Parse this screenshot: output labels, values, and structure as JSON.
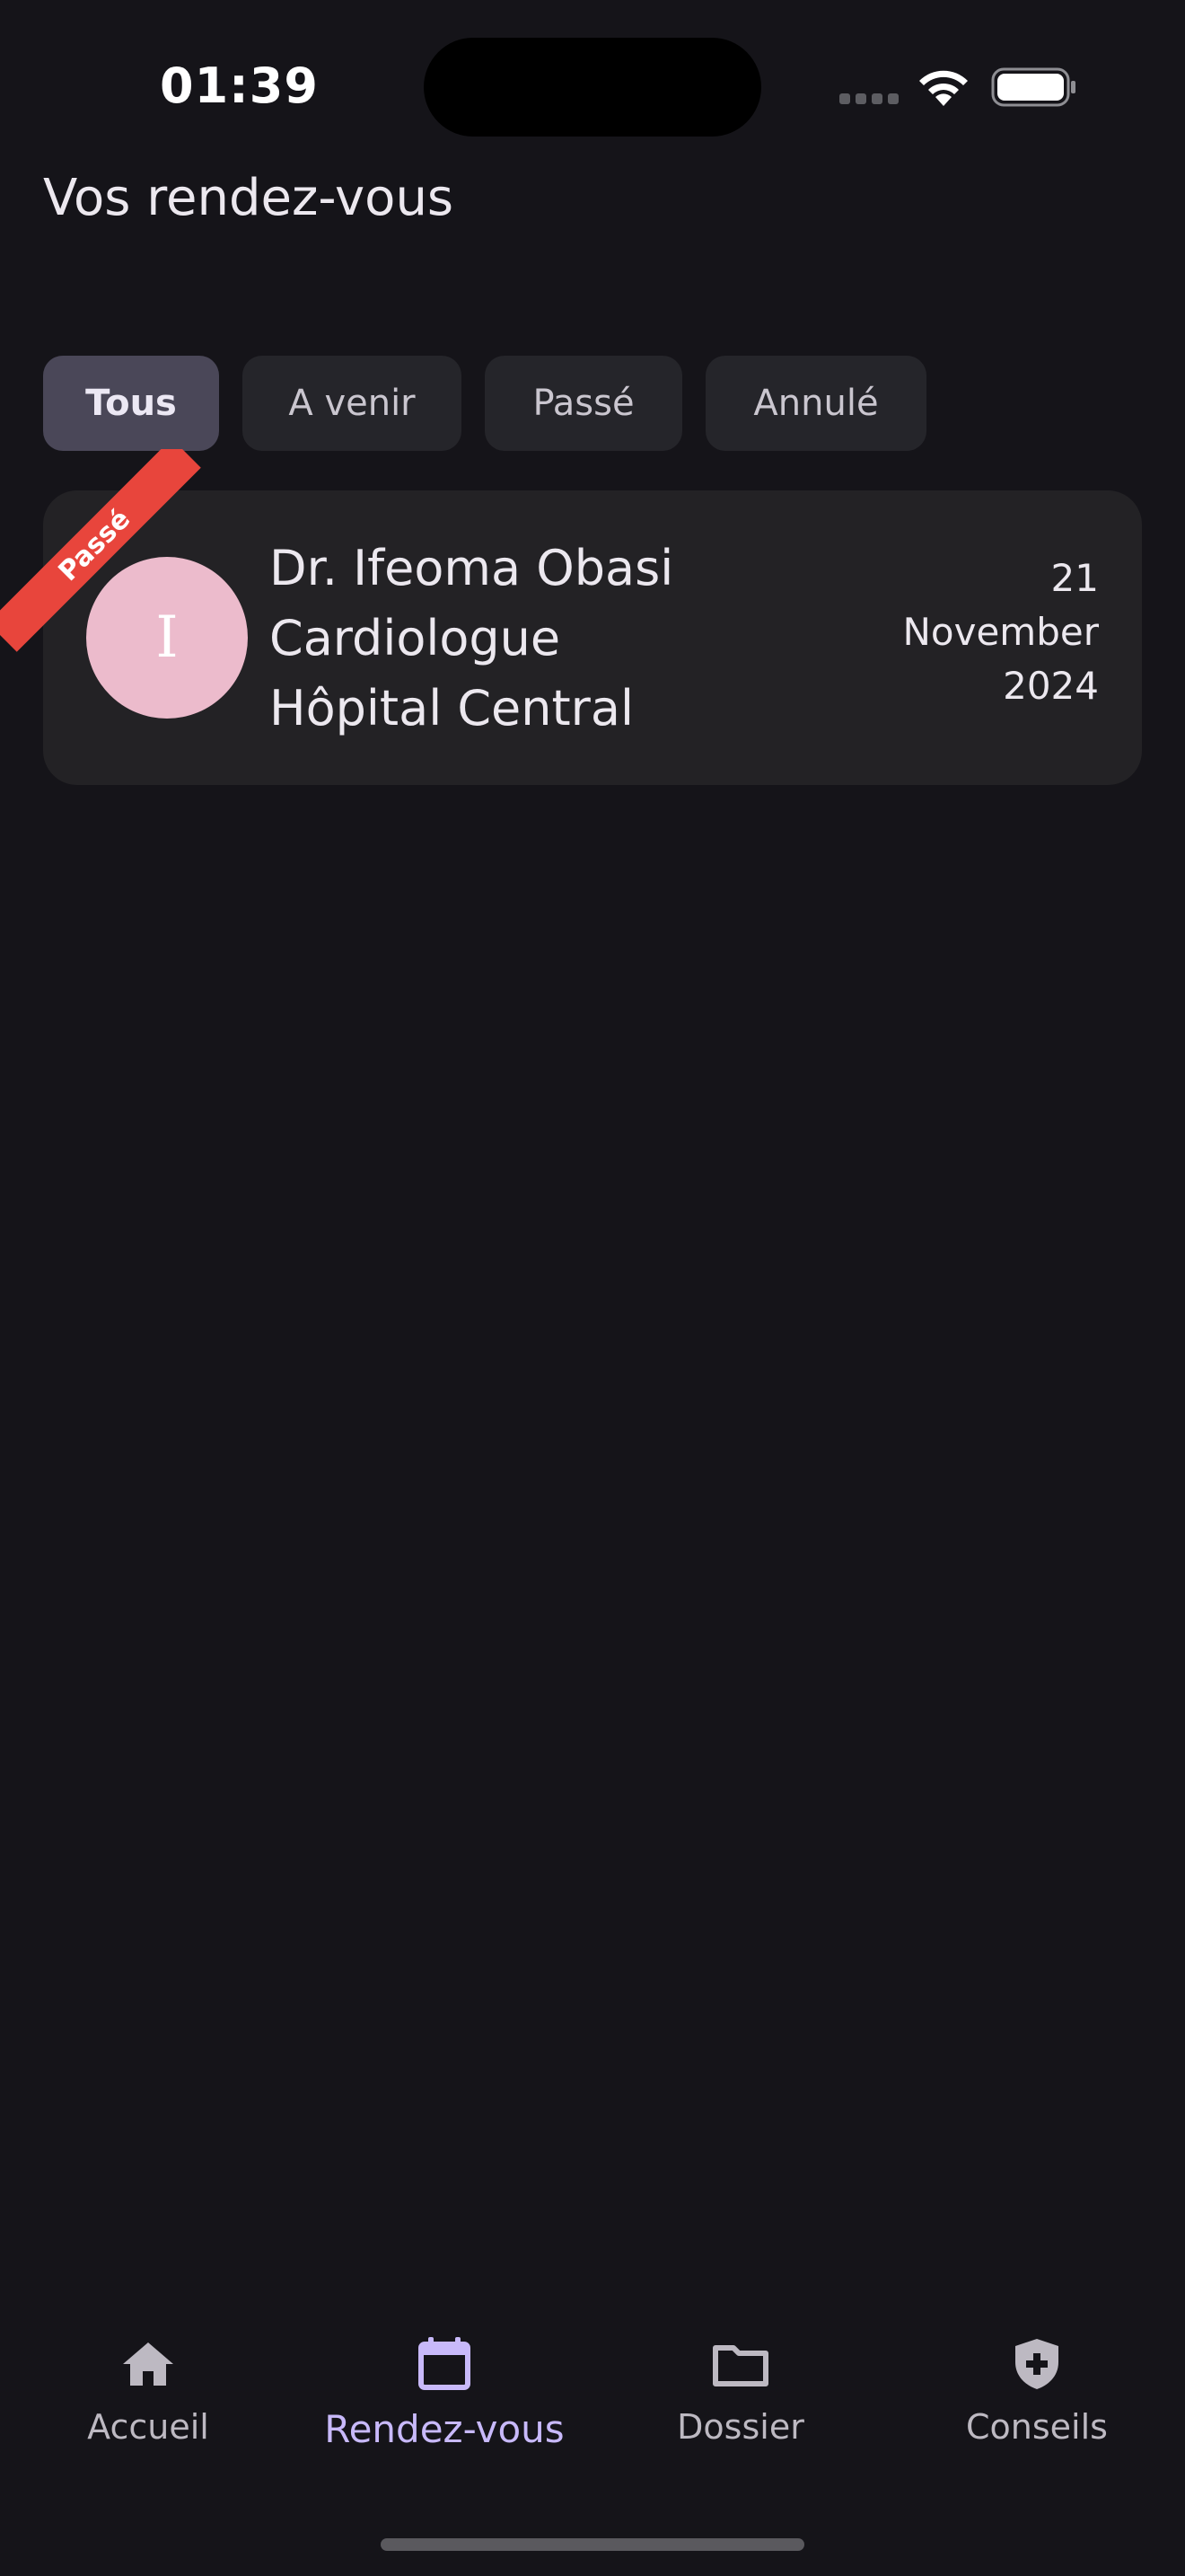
{
  "status_bar": {
    "time": "01:39"
  },
  "header": {
    "title": "Vos rendez-vous"
  },
  "filters": [
    {
      "label": "Tous",
      "active": true
    },
    {
      "label": "A venir",
      "active": false
    },
    {
      "label": "Passé",
      "active": false
    },
    {
      "label": "Annulé",
      "active": false
    }
  ],
  "appointments": [
    {
      "status": "Passé",
      "avatar_initial": "I",
      "doctor": "Dr. Ifeoma Obasi",
      "specialty": "Cardiologue",
      "hospital": "Hôpital Central",
      "date_day": "21",
      "date_month": "November",
      "date_year": "2024",
      "avatar_color": "#ECBBCC",
      "status_color": "#E8453C"
    }
  ],
  "bottom_nav": [
    {
      "label": "Accueil",
      "icon": "home-icon",
      "active": false
    },
    {
      "label": "Rendez-vous",
      "icon": "calendar-icon",
      "active": true
    },
    {
      "label": "Dossier",
      "icon": "folder-icon",
      "active": false
    },
    {
      "label": "Conseils",
      "icon": "shield-plus-icon",
      "active": false
    }
  ],
  "colors": {
    "background": "#151419",
    "accent": "#C8B9FA"
  }
}
